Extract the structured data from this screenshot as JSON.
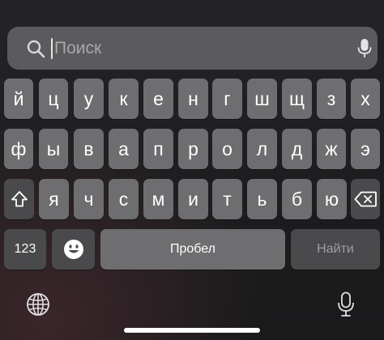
{
  "search": {
    "placeholder": "Поиск",
    "value": "",
    "left_icon": "search-icon",
    "right_icon": "microphone-icon"
  },
  "keyboard": {
    "row1": [
      "й",
      "ц",
      "у",
      "к",
      "е",
      "н",
      "г",
      "ш",
      "щ",
      "з",
      "х"
    ],
    "row2": [
      "ф",
      "ы",
      "в",
      "а",
      "п",
      "р",
      "о",
      "л",
      "д",
      "ж",
      "э"
    ],
    "row3": [
      "я",
      "ч",
      "с",
      "м",
      "и",
      "т",
      "ь",
      "б",
      "ю"
    ],
    "shift_icon": "shift-arrow-icon",
    "backspace_icon": "backspace-icon",
    "numbers_label": "123",
    "emoji_icon": "emoji-icon",
    "space_label": "Пробел",
    "go_label": "Найти"
  },
  "bottom_bar": {
    "globe_icon": "globe-icon",
    "dictation_icon": "microphone-icon"
  },
  "colors": {
    "key": "#6e6e71",
    "key_dark": "#4a4a4d",
    "search_bg": "#5b5b5e",
    "background": "#1c1c1e"
  }
}
